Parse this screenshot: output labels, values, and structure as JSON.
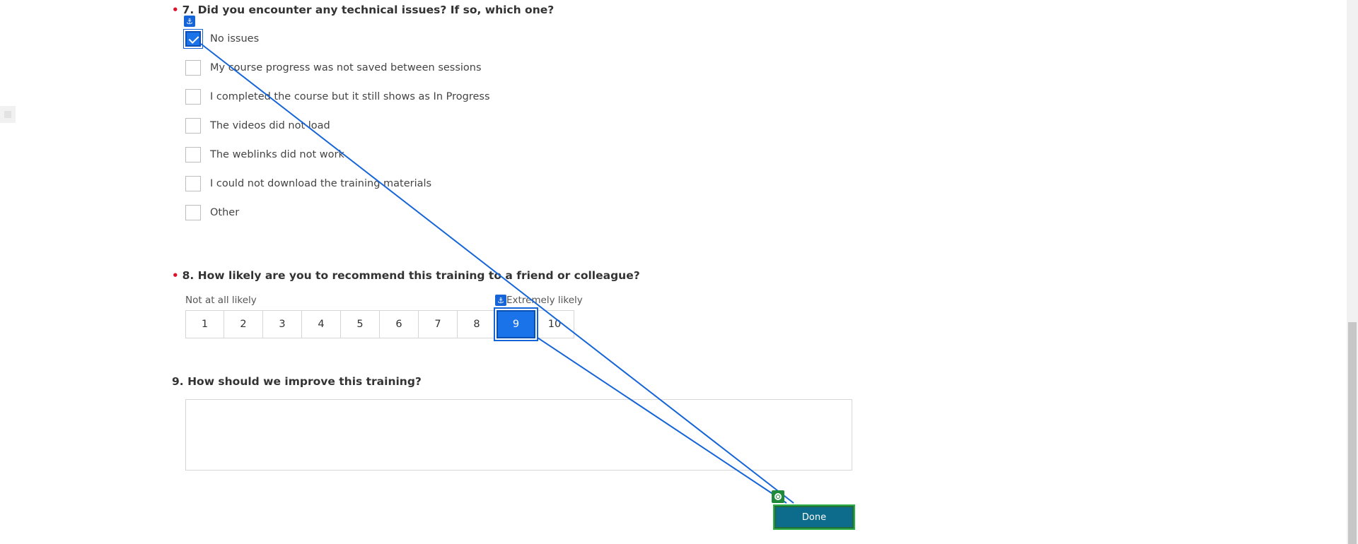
{
  "q7": {
    "number_label": "7. Did you encounter any technical issues? If so, which one?",
    "required_mark": "•",
    "options": [
      {
        "label": "No issues",
        "checked": true
      },
      {
        "label": "My course progress was not saved between sessions",
        "checked": false
      },
      {
        "label": "I completed the course but it still shows as In Progress",
        "checked": false
      },
      {
        "label": "The videos did not load",
        "checked": false
      },
      {
        "label": "The weblinks did not work",
        "checked": false
      },
      {
        "label": "I could not download the training materials",
        "checked": false
      },
      {
        "label": "Other",
        "checked": false
      }
    ]
  },
  "q8": {
    "number_label": "8. How likely are you to recommend this training to a friend or colleague?",
    "required_mark": "•",
    "low_label": "Not at all likely",
    "high_label": "Extremely likely",
    "scale": [
      "1",
      "2",
      "3",
      "4",
      "5",
      "6",
      "7",
      "8",
      "9",
      "10"
    ],
    "selected": "9"
  },
  "q9": {
    "number_label": "9. How should we improve this training?",
    "answer": ""
  },
  "done_button": {
    "label": "Done"
  },
  "icons": {
    "anchor": "anchor-icon",
    "target": "target-icon",
    "check": "checkmark-icon"
  },
  "colors": {
    "accent": "#1a73e8",
    "required": "#e0102a",
    "done_button": "#0d6b8c",
    "target_highlight": "#2fae48"
  }
}
